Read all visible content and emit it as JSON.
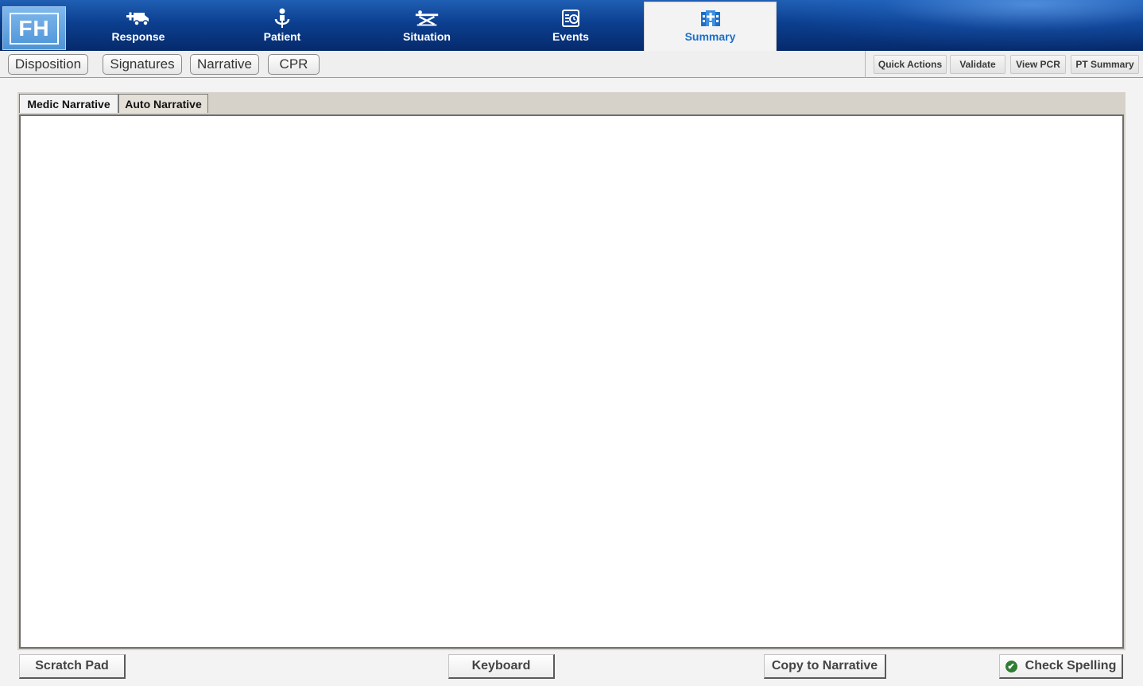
{
  "logo": {
    "text": "FH"
  },
  "nav": {
    "items": [
      {
        "label": "Response",
        "icon": "ambulance-icon"
      },
      {
        "label": "Patient",
        "icon": "person-icon"
      },
      {
        "label": "Situation",
        "icon": "stretcher-icon"
      },
      {
        "label": "Events",
        "icon": "clock-list-icon"
      },
      {
        "label": "Summary",
        "icon": "hospital-icon",
        "active": true
      }
    ]
  },
  "subtabs": [
    "Disposition",
    "Signatures",
    "Narrative",
    "CPR"
  ],
  "quick_actions": [
    "Quick Actions",
    "Validate",
    "View PCR",
    "PT Summary"
  ],
  "narrative": {
    "tabs": [
      {
        "label": "Medic Narrative",
        "active": true
      },
      {
        "label": "Auto Narrative",
        "active": false
      }
    ],
    "text": ""
  },
  "footer": {
    "scratch_pad": "Scratch Pad",
    "keyboard": "Keyboard",
    "copy_to_narrative": "Copy to Narrative",
    "check_spelling": "Check Spelling"
  },
  "colors": {
    "nav_blue": "#0c3f8f",
    "active_tab_text": "#1b6fc9",
    "check_green": "#2f7d32"
  }
}
